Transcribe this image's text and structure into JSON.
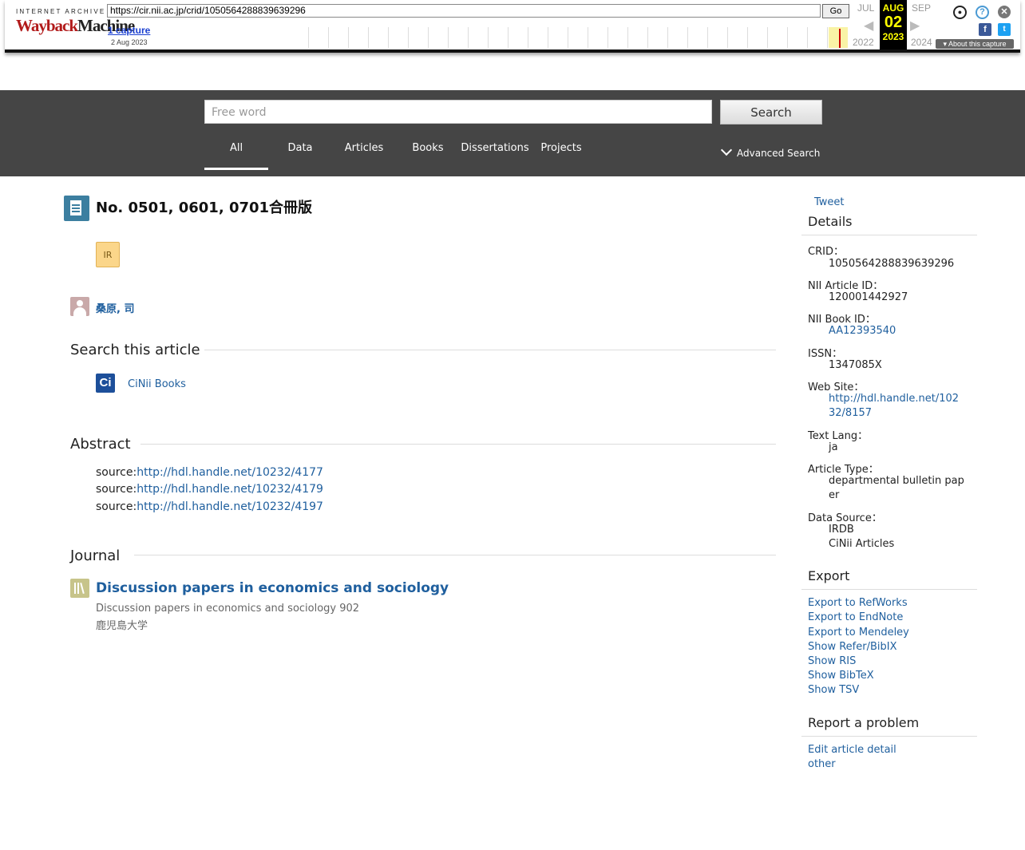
{
  "wayback": {
    "logo_top": "INTERNET ARCHIVE",
    "logo_main_a": "Wayback",
    "logo_main_b": "Machine",
    "url": "https://cir.nii.ac.jp/crid/1050564288839639296",
    "go_label": "Go",
    "captures": "1 capture",
    "capture_date": "2 Aug 2023",
    "prev_month": "JUL",
    "cur_month": "AUG",
    "next_month": "SEP",
    "cur_day": "02",
    "prev_year": "2022",
    "cur_year": "2023",
    "next_year": "2024",
    "about": "About this capture"
  },
  "header": {
    "search_placeholder": "Free word",
    "search_button": "Search",
    "tabs": [
      "All",
      "Data",
      "Articles",
      "Books",
      "Dissertations",
      "Projects"
    ],
    "advanced": "Advanced Search"
  },
  "article": {
    "title": "No. 0501, 0601, 0701合冊版",
    "badge": "IR",
    "author": "桑原, 司"
  },
  "sections": {
    "search_article": "Search this article",
    "cinii_books": "CiNii Books",
    "abstract": "Abstract",
    "source_prefix": "source:",
    "sources": [
      "http://hdl.handle.net/10232/4177",
      "http://hdl.handle.net/10232/4179",
      "http://hdl.handle.net/10232/4197"
    ],
    "journal": "Journal",
    "journal_title": "Discussion papers in economics and sociology",
    "journal_sub": "Discussion papers in economics and sociology 902",
    "journal_pub": "鹿児島大学"
  },
  "sidebar": {
    "tweet": "Tweet",
    "details": "Details",
    "crid_label": "CRID：",
    "crid": "1050564288839639296",
    "nii_article_label": "NII Article ID：",
    "nii_article": "120001442927",
    "nii_book_label": "NII Book ID：",
    "nii_book": "AA12393540",
    "issn_label": "ISSN：",
    "issn": "1347085X",
    "website_label": "Web Site：",
    "website": "http://hdl.handle.net/10232/8157",
    "lang_label": "Text Lang：",
    "lang": "ja",
    "type_label": "Article Type：",
    "type": "departmental bulletin paper",
    "source_label": "Data Source：",
    "source_1": "IRDB",
    "source_2": "CiNii Articles",
    "export": "Export",
    "export_links": [
      "Export to RefWorks",
      "Export to EndNote",
      "Export to Mendeley",
      "Show Refer/BibIX",
      "Show RIS",
      "Show BibTeX",
      "Show TSV"
    ],
    "report": "Report a problem",
    "report_links": [
      "Edit article detail",
      "other"
    ]
  }
}
